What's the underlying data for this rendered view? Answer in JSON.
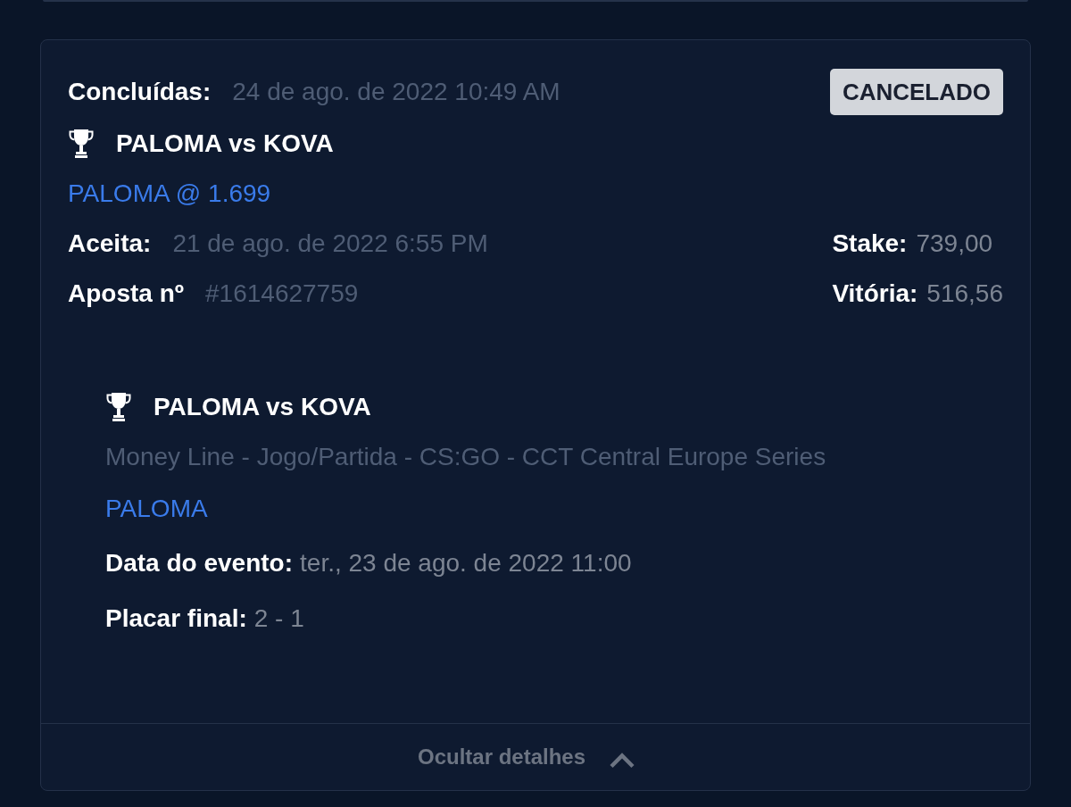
{
  "bet": {
    "status_label": "Concluídas:",
    "completed_at": "24 de ago. de 2022 10:49 AM",
    "badge": "CANCELADO",
    "match": "PALOMA vs KOVA",
    "selection": "PALOMA @ 1.699",
    "fields": [
      {
        "label": "Aceita:",
        "value": "21 de ago. de 2022 6:55 PM"
      },
      {
        "label": "Aposta nº",
        "value": "#1614627759"
      }
    ],
    "amounts": [
      {
        "label": "Stake:",
        "value": "739,00"
      },
      {
        "label": "Vitória:",
        "value": "516,56"
      }
    ]
  },
  "details": {
    "match": "PALOMA vs KOVA",
    "market": "Money Line - Jogo/Partida - CS:GO - CCT Central Europe Series",
    "selection": "PALOMA",
    "fields": [
      {
        "label": "Data do evento:",
        "value": "ter., 23 de ago. de 2022 11:00"
      },
      {
        "label": "Placar final:",
        "value": "2 - 1"
      }
    ]
  },
  "footer": {
    "toggle_label": "Ocultar detalhes",
    "expanded": true
  }
}
